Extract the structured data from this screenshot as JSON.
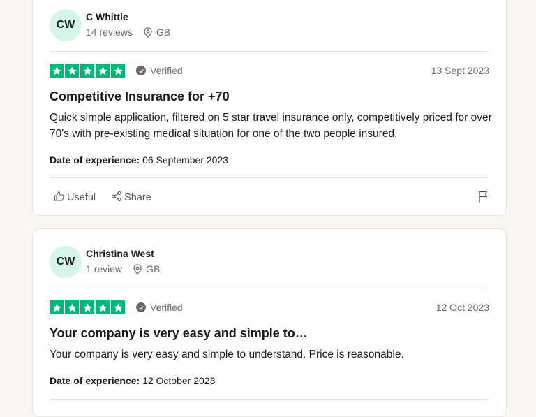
{
  "reviews": [
    {
      "initials": "CW",
      "name": "C Whittle",
      "review_count": "14 reviews",
      "country": "GB",
      "rating": 5,
      "verified_label": "Verified",
      "date": "13 Sept 2023",
      "title": "Competitive Insurance for +70",
      "body": "Quick simple application, filtered on 5 star travel insurance only, competitively priced for over 70's with pre-existing medical situation for one of the two people insured.",
      "experience_label": "Date of experience:",
      "experience_date": "06 September 2023",
      "useful_label": "Useful",
      "share_label": "Share"
    },
    {
      "initials": "CW",
      "name": "Christina West",
      "review_count": "1 review",
      "country": "GB",
      "rating": 5,
      "verified_label": "Verified",
      "date": "12 Oct 2023",
      "title": "Your company is very easy and simple to…",
      "body": "Your company is very easy and simple to understand. Price is reasonable.",
      "experience_label": "Date of experience:",
      "experience_date": "12 October 2023"
    }
  ],
  "colors": {
    "star_green": "#00b67a",
    "avatar_bg": "#d5f5e8",
    "page_bg": "#f8f7f1"
  },
  "icons": {
    "star": "star-icon",
    "verified": "check-circle-icon",
    "location": "location-pin-icon",
    "useful": "thumbs-up-icon",
    "share": "share-icon",
    "flag": "flag-icon"
  }
}
